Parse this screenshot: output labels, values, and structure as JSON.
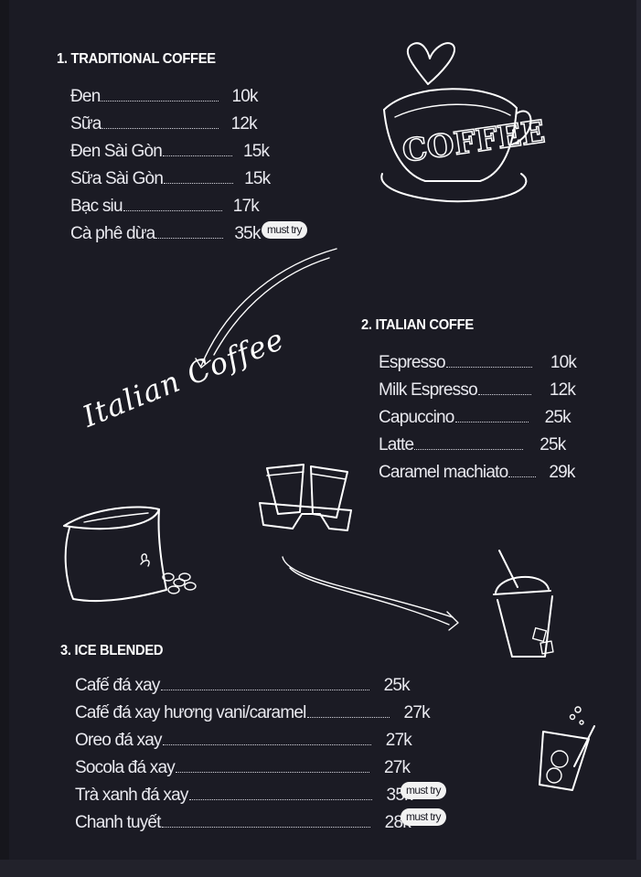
{
  "sections": [
    {
      "title": "1. TRADITIONAL COFFEE",
      "items": [
        {
          "name": "Đen",
          "price": "10k"
        },
        {
          "name": "Sữa",
          "price": "12k"
        },
        {
          "name": "Đen Sài Gòn",
          "price": "15k"
        },
        {
          "name": "Sữa Sài Gòn",
          "price": "15k"
        },
        {
          "name": "Bạc siu",
          "price": "17k"
        },
        {
          "name": "Cà phê dừa",
          "price": "35k",
          "badge": "must try"
        }
      ]
    },
    {
      "title": "2.  ITALIAN COFFE",
      "items": [
        {
          "name": "Espresso",
          "price": "10k"
        },
        {
          "name": "Milk Espresso",
          "price": "12k"
        },
        {
          "name": "Capuccino",
          "price": "25k"
        },
        {
          "name": "Latte",
          "price": "25k"
        },
        {
          "name": "Caramel machiato",
          "price": "29k"
        }
      ]
    },
    {
      "title": "3. ICE BLENDED",
      "items": [
        {
          "name": "Cafế đá xay",
          "price": "25k"
        },
        {
          "name": "Cafế đá xay hương vani/caramel",
          "price": "27k"
        },
        {
          "name": "Oreo đá xay",
          "price": "27k"
        },
        {
          "name": "Socola đá xay",
          "price": "27k"
        },
        {
          "name": "Trà xanh đá xay",
          "price": "35k",
          "badge": "must try"
        },
        {
          "name": "Chanh tuyết",
          "price": "28k",
          "badge": "must try"
        }
      ]
    }
  ],
  "decor": {
    "cup_text": "COFFEE",
    "script_text": "Italian Coffee"
  },
  "colors": {
    "background": "#1b1b24",
    "text": "#e9e9ef",
    "badge_bg": "#f2f2f2"
  },
  "icons": [
    "coffee-cup-icon",
    "coffee-bag-icon",
    "takeaway-cups-icon",
    "iced-drink-icon",
    "lemonade-icon",
    "arrow-icon"
  ]
}
